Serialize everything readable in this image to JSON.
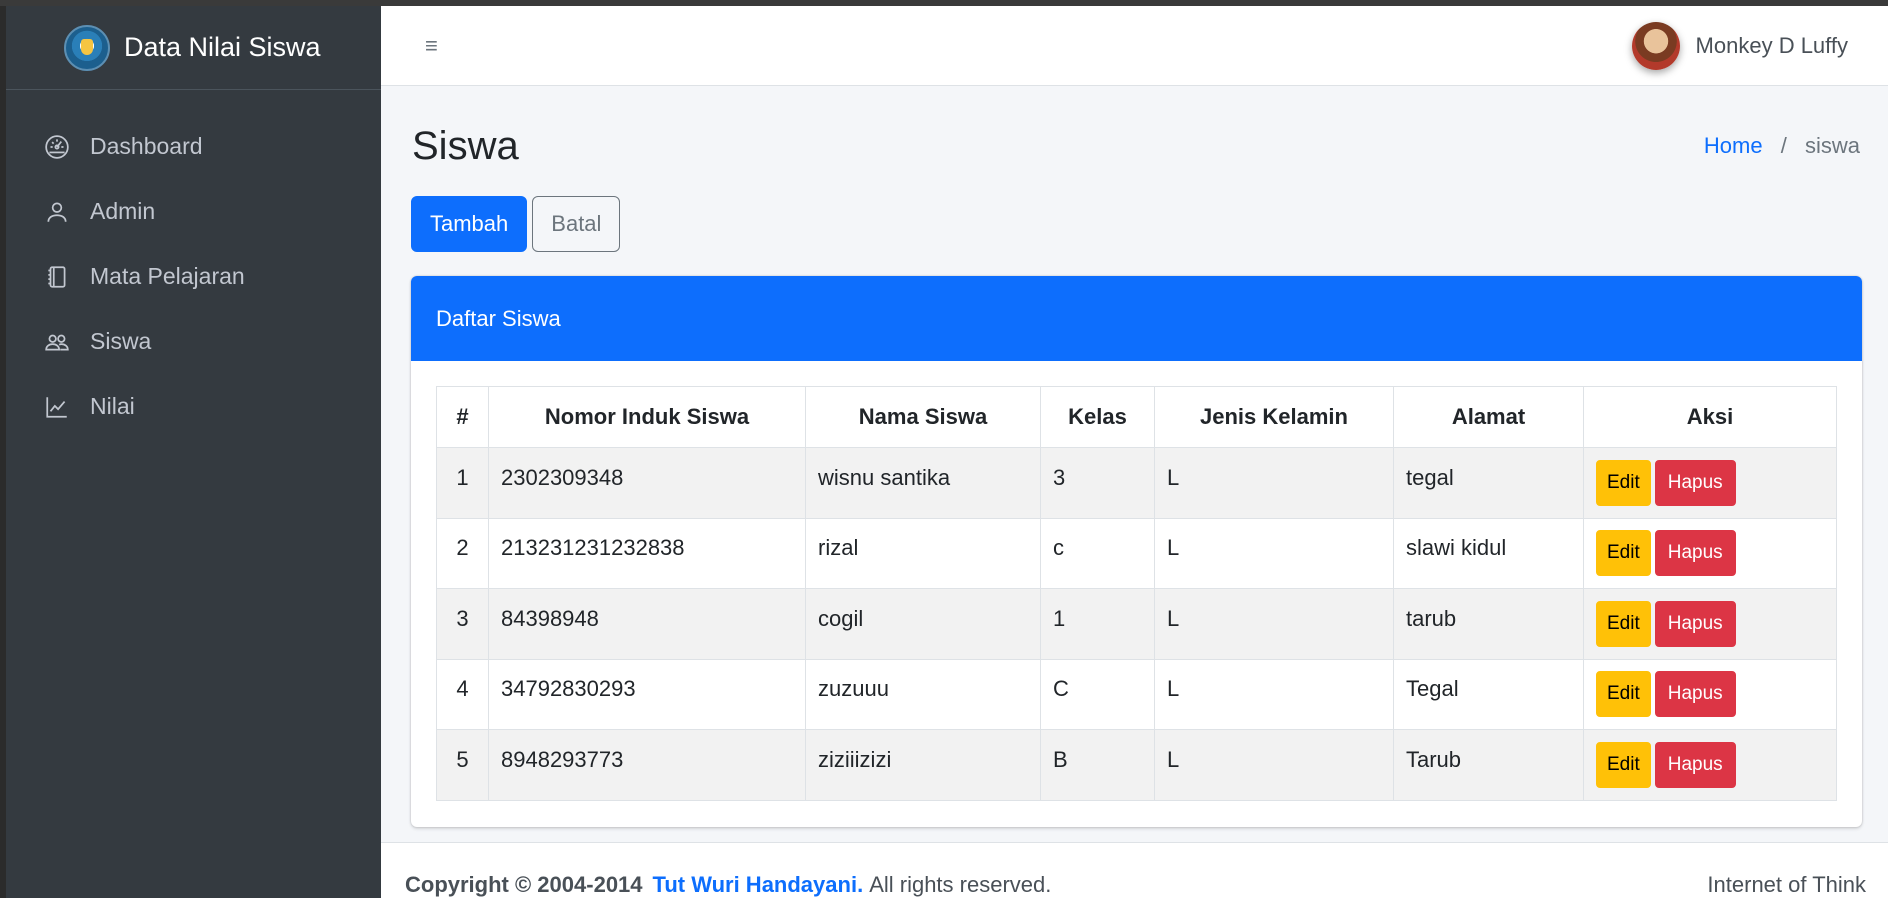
{
  "brand": {
    "title": "Data Nilai Siswa"
  },
  "sidebar": {
    "items": [
      {
        "label": "Dashboard",
        "icon": "dashboard-icon"
      },
      {
        "label": "Admin",
        "icon": "user-icon"
      },
      {
        "label": "Mata Pelajaran",
        "icon": "journals-icon"
      },
      {
        "label": "Siswa",
        "icon": "people-icon"
      },
      {
        "label": "Nilai",
        "icon": "graph-icon"
      }
    ]
  },
  "topbar": {
    "menu_icon": "≡",
    "user_name": "Monkey D Luffy"
  },
  "page": {
    "title": "Siswa"
  },
  "breadcrumb": {
    "home": "Home",
    "separator": "/",
    "current": "siswa"
  },
  "actions": {
    "add_label": "Tambah",
    "cancel_label": "Batal"
  },
  "card": {
    "title": "Daftar Siswa"
  },
  "table": {
    "headers": [
      "#",
      "Nomor Induk Siswa",
      "Nama Siswa",
      "Kelas",
      "Jenis Kelamin",
      "Alamat",
      "Aksi"
    ],
    "rows": [
      {
        "no": "1",
        "nis": "2302309348",
        "nama": "wisnu santika",
        "kelas": "3",
        "jk": "L",
        "alamat": "tegal"
      },
      {
        "no": "2",
        "nis": "213231231232838",
        "nama": "rizal",
        "kelas": "c",
        "jk": "L",
        "alamat": "slawi kidul"
      },
      {
        "no": "3",
        "nis": "84398948",
        "nama": "cogil",
        "kelas": "1",
        "jk": "L",
        "alamat": "tarub"
      },
      {
        "no": "4",
        "nis": "34792830293",
        "nama": "zuzuuu",
        "kelas": "C",
        "jk": "L",
        "alamat": "Tegal"
      },
      {
        "no": "5",
        "nis": "8948293773",
        "nama": "ziziiizizi",
        "kelas": "B",
        "jk": "L",
        "alamat": "Tarub"
      }
    ],
    "edit_label": "Edit",
    "delete_label": "Hapus"
  },
  "footer": {
    "copyright": "Copyright © 2004-2014",
    "link": "Tut Wuri Handayani.",
    "rights": "All rights reserved.",
    "right_text": "Internet of Think"
  },
  "colors": {
    "sidebar_bg": "#343a40",
    "primary": "#0d6efd",
    "warning": "#ffc107",
    "danger": "#dc3545"
  }
}
